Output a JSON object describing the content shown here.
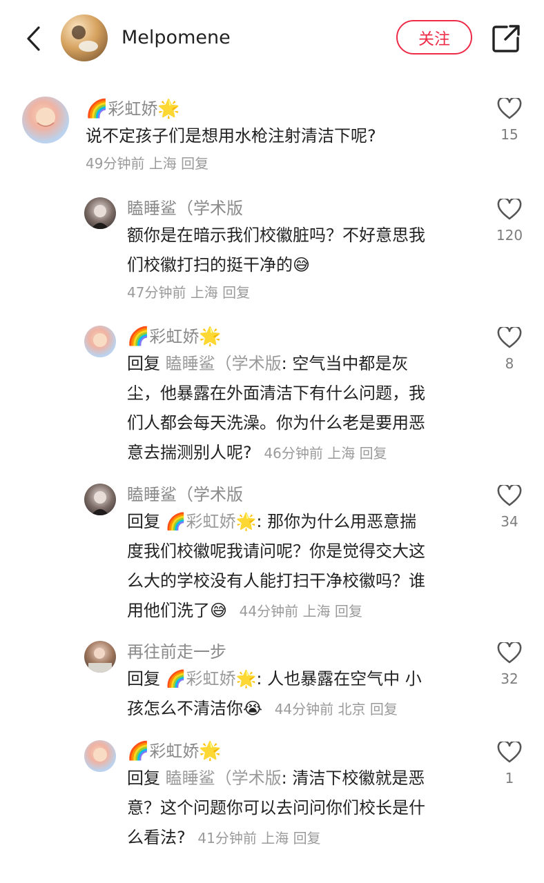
{
  "header": {
    "username": "Melpomene",
    "follow_label": "关注"
  },
  "comments": [
    {
      "name": "彩虹娇",
      "name_prefix_emoji": "🌈",
      "name_suffix_emoji": "🌟",
      "text": "说不定孩子们是想用水枪注射清洁下呢?",
      "time": "49分钟前",
      "location": "上海",
      "reply_label": "回复",
      "likes": "15"
    },
    {
      "name": "瞌睡鲨（学术版",
      "text_line1": "额你是在暗示我们校徽脏吗？不好意思我",
      "text_line2": "们校徽打扫的挺干净的",
      "text_emoji": "😅",
      "time": "47分钟前",
      "location": "上海",
      "reply_label": "回复",
      "likes": "120"
    },
    {
      "name": "彩虹娇",
      "name_prefix_emoji": "🌈",
      "name_suffix_emoji": "🌟",
      "reply_word": "回复",
      "reply_to": "瞌睡鲨（学术版",
      "line1": ": 空气当中都是灰",
      "line2": "尘，他暴露在外面清洁下有什么问题，我",
      "line3": "们人都会每天洗澡。你为什么老是要用恶",
      "line4": "意去揣测别人呢?",
      "time": "46分钟前",
      "location": "上海",
      "reply_label": "回复",
      "likes": "8"
    },
    {
      "name": "瞌睡鲨（学术版",
      "reply_word": "回复",
      "reply_to": "彩虹娇",
      "reply_to_prefix_emoji": "🌈",
      "reply_to_suffix_emoji": "🌟",
      "line1": ": 那你为什么用恶意揣",
      "line2": "度我们校徽呢我请问呢？你是觉得交大这",
      "line3": "么大的学校没有人能打扫干净校徽吗？谁",
      "line4": "用他们洗了",
      "text_emoji": "😅",
      "time": "44分钟前",
      "location": "上海",
      "reply_label": "回复",
      "likes": "34"
    },
    {
      "name": "再往前走一步",
      "reply_word": "回复",
      "reply_to": "彩虹娇",
      "reply_to_prefix_emoji": "🌈",
      "reply_to_suffix_emoji": "🌟",
      "line1": ": 人也暴露在空气中 小",
      "line2": "孩怎么不清洁你",
      "text_emoji": "😭",
      "time": "44分钟前",
      "location": "北京",
      "reply_label": "回复",
      "likes": "32"
    },
    {
      "name": "彩虹娇",
      "name_prefix_emoji": "🌈",
      "name_suffix_emoji": "🌟",
      "reply_word": "回复",
      "reply_to": "瞌睡鲨（学术版",
      "line1": ": 清洁下校徽就是恶",
      "line2": "意？这个问题你可以去问问你们校长是什",
      "line3": "么看法?",
      "time": "41分钟前",
      "location": "上海",
      "reply_label": "回复",
      "likes": "1"
    }
  ],
  "colors": {
    "accent": "#ee2b47",
    "muted_text": "#9a9a9a",
    "body_text": "#222222"
  },
  "icons": {
    "back": "chevron-left-icon",
    "share": "share-external-icon",
    "like": "heart-outline-icon"
  }
}
